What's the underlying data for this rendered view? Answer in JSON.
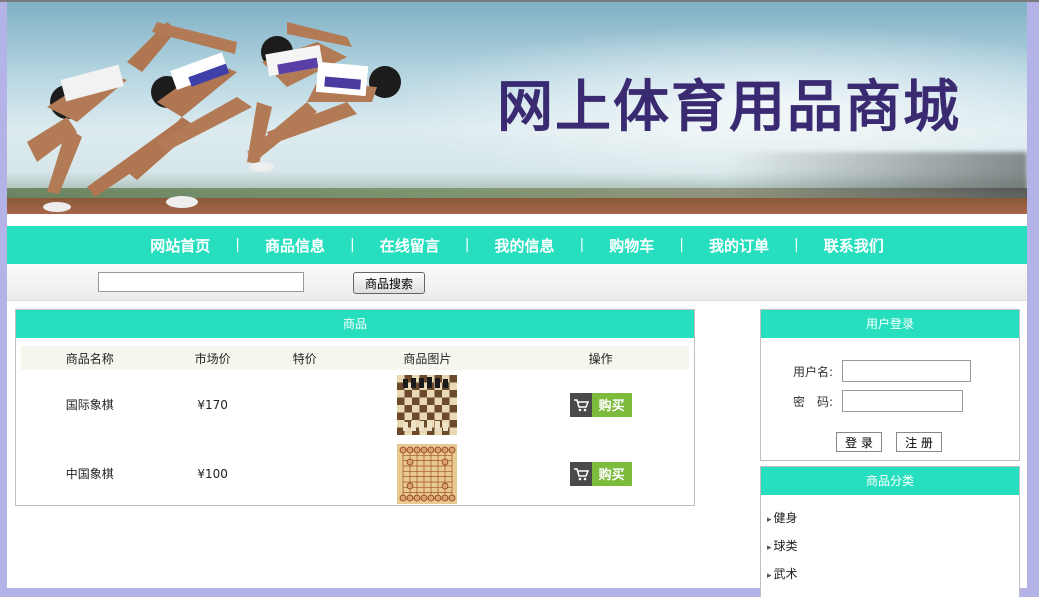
{
  "banner": {
    "title": "网上体育用品商城"
  },
  "nav": [
    {
      "label": "网站首页"
    },
    {
      "label": "商品信息"
    },
    {
      "label": "在线留言"
    },
    {
      "label": "我的信息"
    },
    {
      "label": "购物车"
    },
    {
      "label": "我的订单"
    },
    {
      "label": "联系我们"
    }
  ],
  "nav_separator": "|",
  "search": {
    "value": "",
    "button_label": "商品搜索"
  },
  "products": {
    "title": "商品",
    "columns": [
      "商品名称",
      "市场价",
      "特价",
      "商品图片",
      "操作"
    ],
    "rows": [
      {
        "name": "国际象棋",
        "market_price": "¥170",
        "special_price": "",
        "image_icon": "chess-board-image",
        "action_label": "购买"
      },
      {
        "name": "中国象棋",
        "market_price": "¥100",
        "special_price": "",
        "image_icon": "xiangqi-board-image",
        "action_label": "购买"
      }
    ]
  },
  "login": {
    "title": "用户登录",
    "username_label": "用户名:",
    "password_label": "密　码:",
    "username_value": "",
    "password_value": "",
    "login_label": "登 录",
    "register_label": "注 册"
  },
  "categories": {
    "title": "商品分类",
    "items": [
      "健身",
      "球类",
      "武术"
    ]
  },
  "colors": {
    "accent": "#27dfbf",
    "title_purple": "#3a2a72",
    "buy_green": "#7dbb3c",
    "side_bg": "#b3b3e8"
  }
}
